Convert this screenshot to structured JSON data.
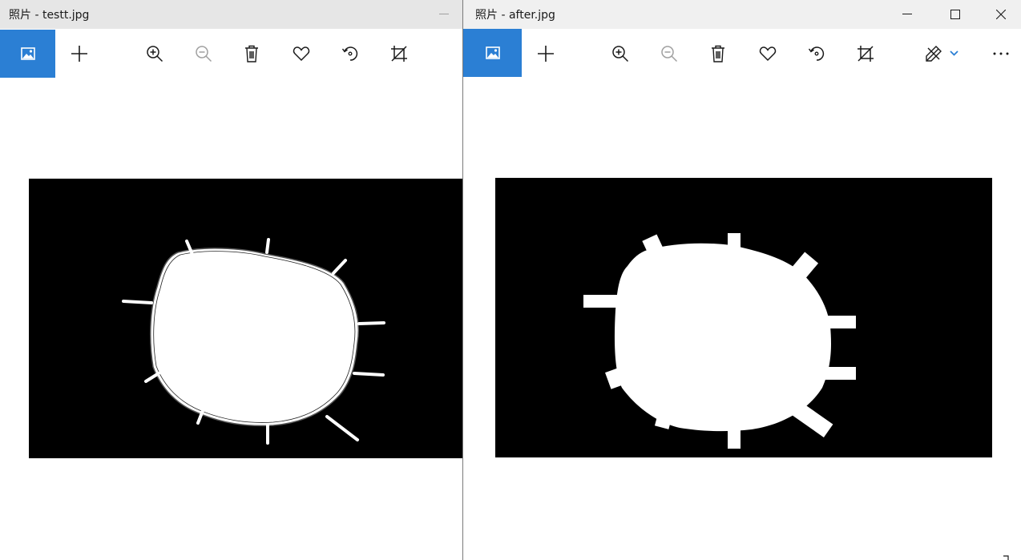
{
  "left_window": {
    "title": "照片 - testt.jpg",
    "toolbar": [
      "view-photo-icon",
      "add-icon",
      "zoom-in-icon",
      "zoom-out-icon",
      "delete-icon",
      "favorite-icon",
      "rotate-icon",
      "crop-icon"
    ],
    "controls": [
      "minimize-icon"
    ]
  },
  "right_window": {
    "title": "照片 - after.jpg",
    "toolbar": [
      "view-photo-icon",
      "add-icon",
      "zoom-in-icon",
      "zoom-out-icon",
      "delete-icon",
      "favorite-icon",
      "rotate-icon",
      "crop-icon",
      "edit-create-icon",
      "chevron-down-icon",
      "more-icon"
    ],
    "controls": [
      "minimize-icon",
      "maximize-icon",
      "close-icon"
    ]
  },
  "colors": {
    "accent": "#2b7fd4",
    "titlebar_left": "#e6e6e6",
    "titlebar_right": "#f0f0f0",
    "icon": "#1a1a1a",
    "icon_disabled": "#a0a0a0",
    "image_background": "#000000",
    "image_foreground": "#ffffff"
  }
}
